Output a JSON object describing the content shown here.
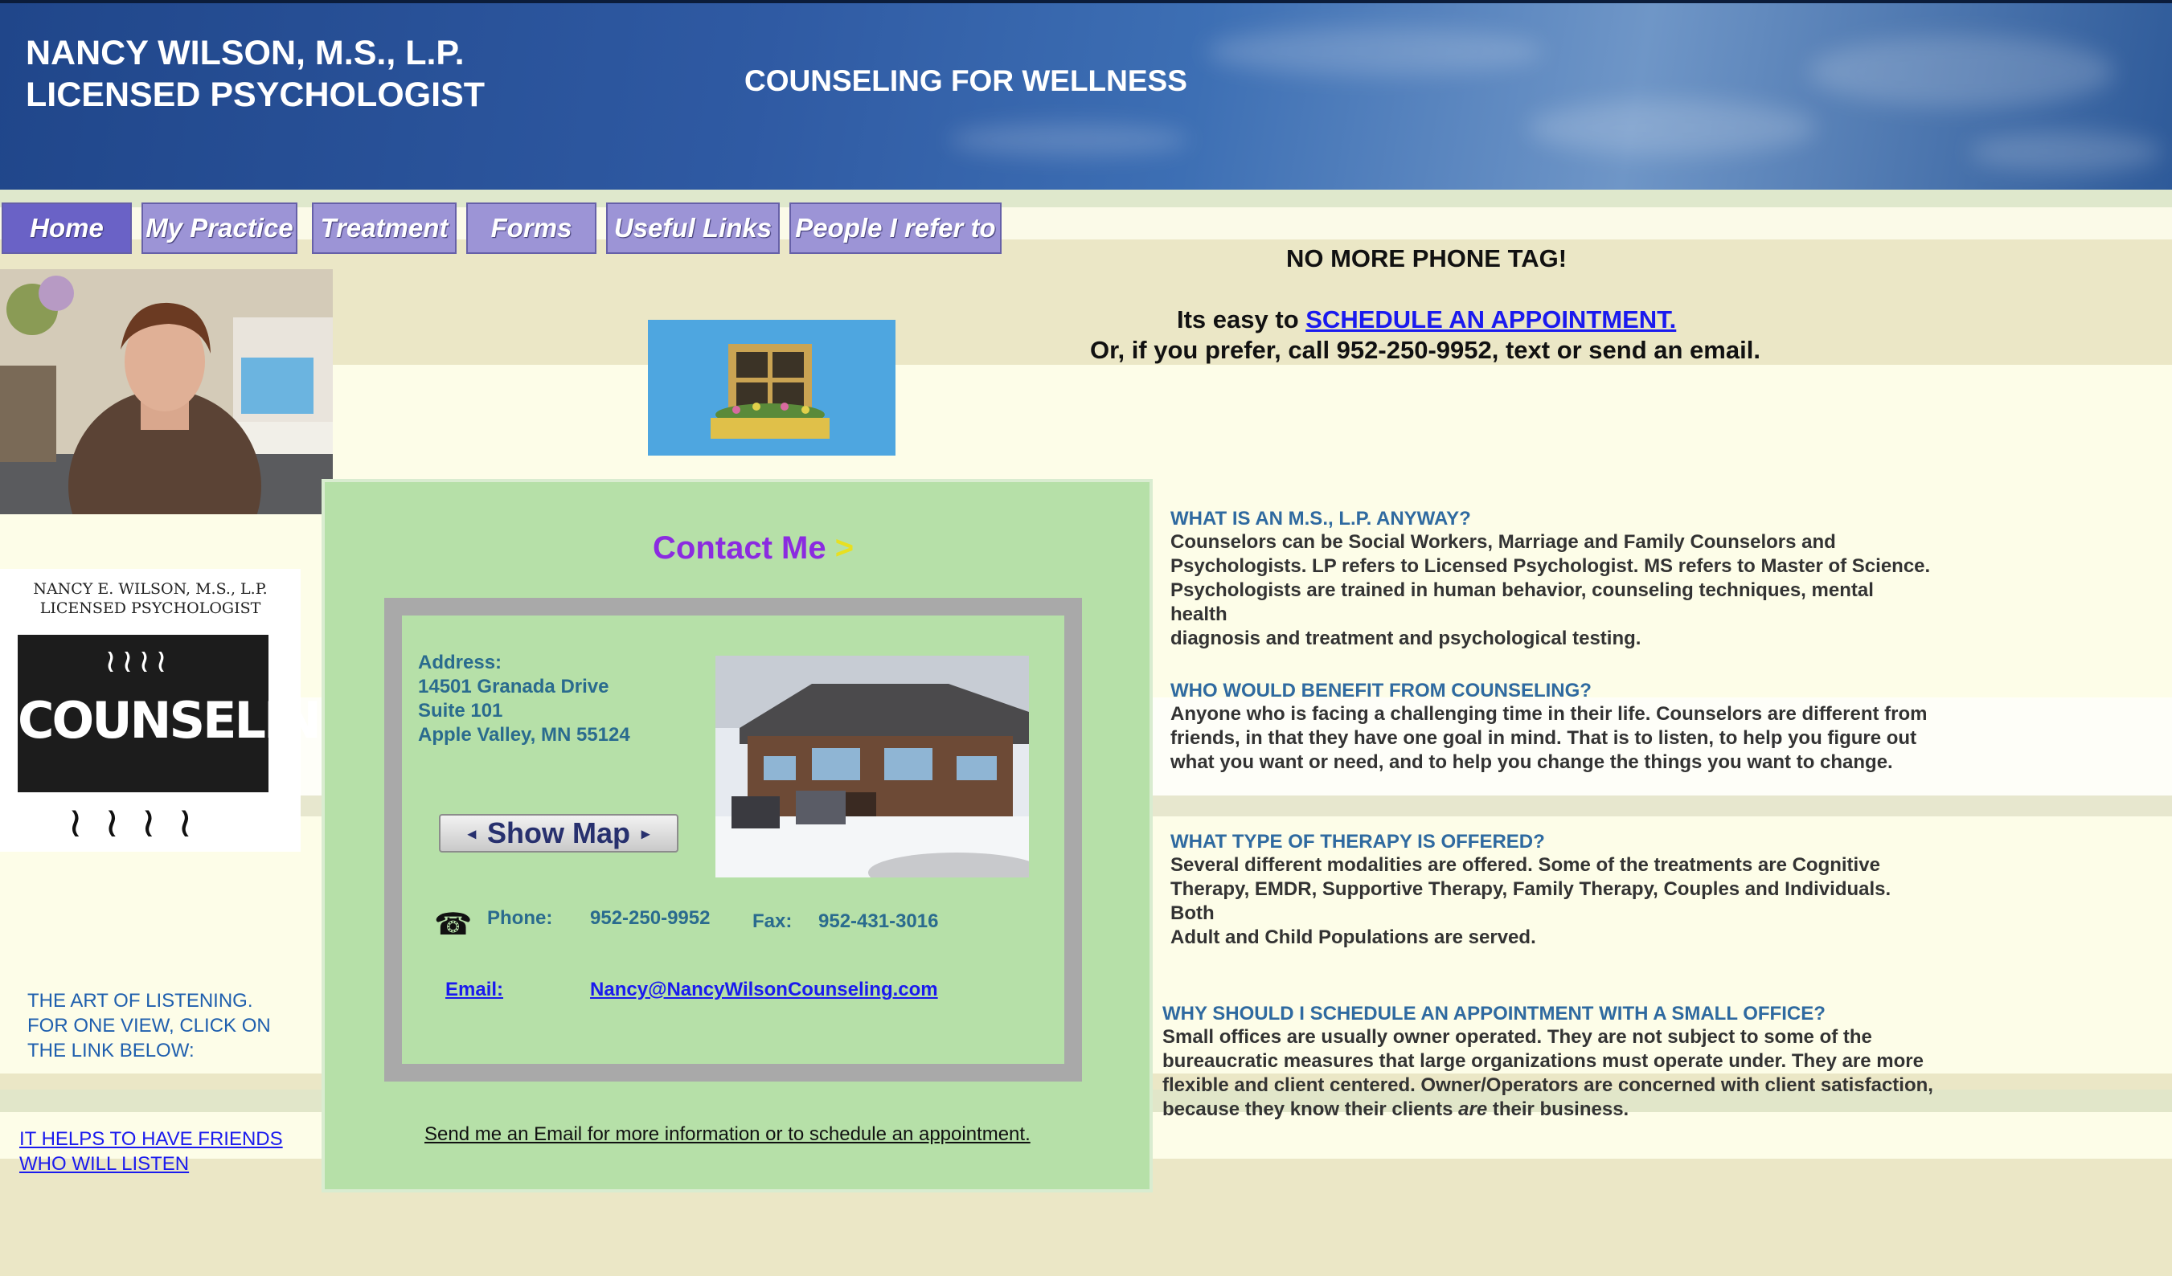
{
  "header": {
    "name_line1": "NANCY WILSON, M.S., L.P.",
    "name_line2": "LICENSED PSYCHOLOGIST",
    "tagline": "COUNSELING FOR WELLNESS"
  },
  "nav": {
    "items": [
      "Home",
      "My Practice",
      "Treatment",
      "Forms",
      "Useful Links",
      "People I refer to"
    ],
    "active": "Home"
  },
  "sidebar": {
    "logo_line1": "NANCY E. WILSON, M.S., L.P.",
    "logo_line2": "LICENSED PSYCHOLOGIST",
    "logo_word": "COUNSELING",
    "art_text": [
      "THE ART OF LISTENING.",
      "FOR ONE VIEW, CLICK ON",
      "THE LINK BELOW:"
    ],
    "friends_link": [
      "IT HELPS TO HAVE FRIENDS",
      "WHO WILL LISTEN"
    ]
  },
  "announcement": {
    "headline": "NO MORE PHONE TAG!",
    "easy_prefix": "Its easy to ",
    "schedule_link": "SCHEDULE AN APPOINTMENT.",
    "call_line": "Or, if you prefer, call 952-250-9952, text or send an email."
  },
  "contact": {
    "title": "Contact Me",
    "title_arrow": ">",
    "address_label": "Address:",
    "address_line1": "14501 Granada Drive",
    "address_line2": "Suite 101",
    "address_line3": "Apple Valley, MN  55124",
    "map_button": "Show Map",
    "phone_label": "Phone:",
    "phone": "952-250-9952",
    "fax_label": "Fax:",
    "fax": "952-431-3016",
    "email_label": "Email:",
    "email": "Nancy@NancyWilsonCounseling.com",
    "send_link": "Send me an Email for more information or to schedule an appointment."
  },
  "faq": [
    {
      "q": "WHAT IS AN M.S., L.P. ANYWAY?",
      "a": [
        "Counselors can be Social Workers, Marriage and Family Counselors and",
        "Psychologists. LP refers to Licensed Psychologist. MS refers to Master of Science.",
        "Psychologists are trained in human behavior, counseling techniques, mental",
        "health",
        "diagnosis and treatment and psychological testing."
      ]
    },
    {
      "q": "WHO WOULD BENEFIT FROM COUNSELING?",
      "a": [
        "Anyone who is facing a challenging time in their life. Counselors are different from",
        "friends, in that they have one goal in mind. That is to listen, to help you figure out",
        "what you want or need, and to help you change the things you want to change."
      ]
    },
    {
      "q": "WHAT TYPE OF THERAPY IS OFFERED?",
      "a": [
        "Several different modalities are offered. Some of the treatments are Cognitive",
        "Therapy, EMDR, Supportive Therapy, Family Therapy, Couples and Individuals.",
        "Both",
        "Adult and Child Populations are served."
      ]
    },
    {
      "q": "WHY SHOULD I SCHEDULE AN APPOINTMENT WITH A SMALL OFFICE?",
      "a": [
        "Small offices are usually owner operated. They are not subject to some of the",
        "bureaucratic measures that large organizations must operate under. They are more",
        "flexible and client centered. Owner/Operators are concerned with client satisfaction,"
      ],
      "last_prefix": "because they know their clients ",
      "last_em": "are",
      "last_suffix": " their business."
    }
  ]
}
